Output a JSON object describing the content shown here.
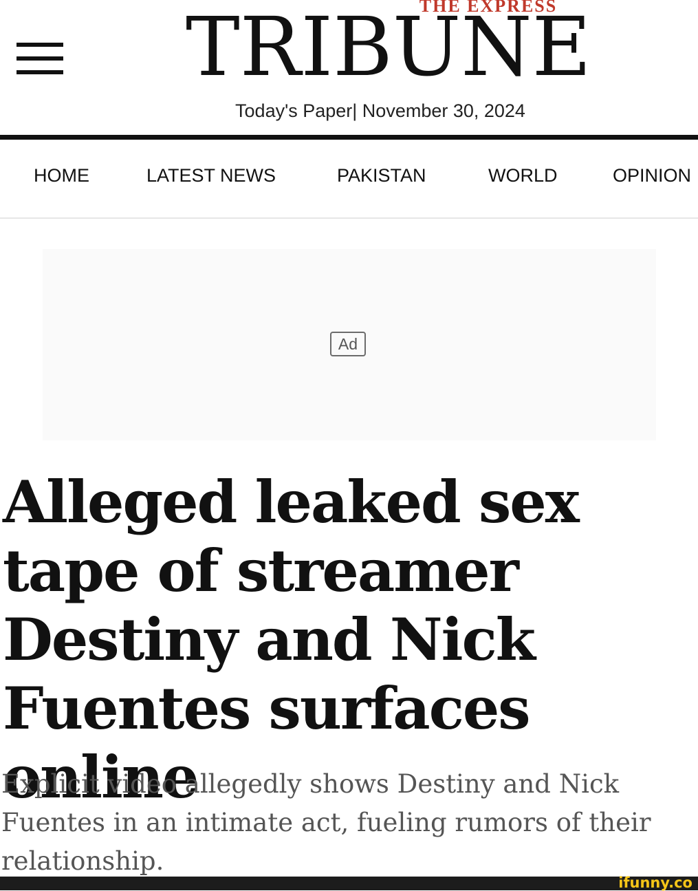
{
  "header": {
    "menu_icon": "hamburger-menu-icon",
    "kicker": "THE EXPRESS",
    "masthead": "TRIBUNE",
    "todays_paper": "Today's Paper| November 30, 2024"
  },
  "nav": {
    "items": [
      "HOME",
      "LATEST NEWS",
      "PAKISTAN",
      "WORLD",
      "OPINION"
    ]
  },
  "ad": {
    "label": "Ad"
  },
  "article": {
    "headline": "Alleged leaked sex tape of streamer Destiny and Nick Fuentes surfaces online",
    "subheadline": "Explicit video allegedly shows Destiny and Nick Fuentes in an intimate act, fueling rumors of their relationship."
  },
  "watermark": "ifunny.co",
  "colors": {
    "kicker_red": "#c0392b",
    "text_dark": "#111111",
    "subhead_gray": "#555555",
    "watermark_yellow": "#f5c518"
  }
}
